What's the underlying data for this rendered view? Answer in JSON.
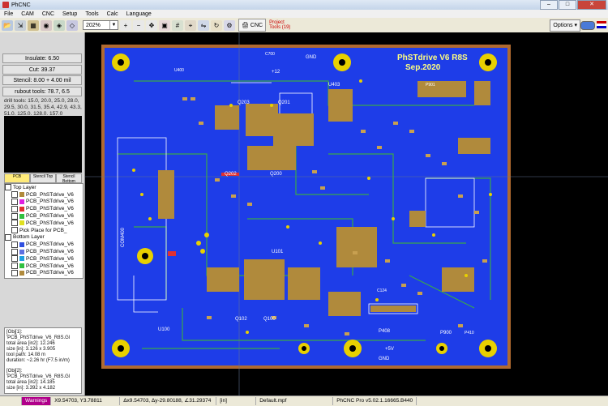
{
  "window": {
    "title": "PhCNC"
  },
  "menu": [
    "File",
    "CAM",
    "CNC",
    "Setup",
    "Tools",
    "Calc",
    "Language"
  ],
  "toolbar": {
    "zoom": "202%",
    "cnc_label": "CNC",
    "project_tools": "Project Tools (19)",
    "options_label": "Options"
  },
  "sidepanel": {
    "insulate": "Insulate: 6.50",
    "cut": "Cut: 39.37",
    "stencil": "Stencil: 8.00 + 4.00 mil",
    "rubout": "rubout tools: 78.7, 6.5",
    "drill_tools": "drill tools: 15.0, 20.0, 25.0, 28.0, 29.5, 30.0, 31.5, 35.4, 42.9, 43.3, 51.0, 125.0, 128.0, 157.0"
  },
  "tabs": [
    "PCB",
    "Stencil Top",
    "Stencil Bottom"
  ],
  "layers": {
    "top_label": "Top Layer",
    "top": [
      "PCB_PhSTdrive_V6",
      "PCB_PhSTdrive_V6",
      "PCB_PhSTdrive_V6",
      "PCB_PhSTdrive_V6",
      "PCB_PhSTdrive_V6",
      "Pick Place for PCB_"
    ],
    "bottom_label": "Bottom Layer",
    "bottom": [
      "PCB_PhSTdrive_V6",
      "PCB_PhSTdrive_V6",
      "PCB_PhSTdrive_V6",
      "PCB_PhSTdrive_V6",
      "PCB_PhSTdrive_V6"
    ]
  },
  "info": [
    "[Obj[1]: 'PCB_PhSTdrive_V6_R8S.Gl",
    "total area [in2]: 12.246",
    "size [in]: 3.126 x 3.905",
    "tool path: 14.08 m",
    "duration: ~2.26 hr (F7.5 in/m)",
    "",
    "[Obj[2]: 'PCB_PhSTdrive_V6_R8S.Gl",
    "total area [in2]: 14.185",
    "size [in]: 3.392 x 4.182"
  ],
  "status": {
    "warning": "Warnings",
    "coords": "X9.54703, Y3.78811",
    "delta": "Δx9.54703, Δy-29.80188, ∠31.29374",
    "units": "[in]",
    "file": "Default.mpf",
    "version": "PhCNC Pro v5.02.1.16665.B440"
  },
  "board": {
    "title_text": "PhSTdrive V6 R8S",
    "date_text": "Sep.2020",
    "labels": [
      "C700",
      "GND",
      "+12",
      "U400",
      "U403",
      "P901",
      "Q203",
      "Q201",
      "Q202",
      "Q200",
      "COM400",
      "U101",
      "Q102",
      "Q100",
      "U100",
      "P900",
      "P408",
      "GND",
      "+5V",
      "C124",
      "P410"
    ]
  },
  "colors": {
    "board_blue": "#1e3de8",
    "pad_copper": "#b08a3c",
    "silk_white": "#ffffff",
    "trace_green": "#3aa84a",
    "background": "#000000",
    "via_yellow": "#e8d000"
  }
}
